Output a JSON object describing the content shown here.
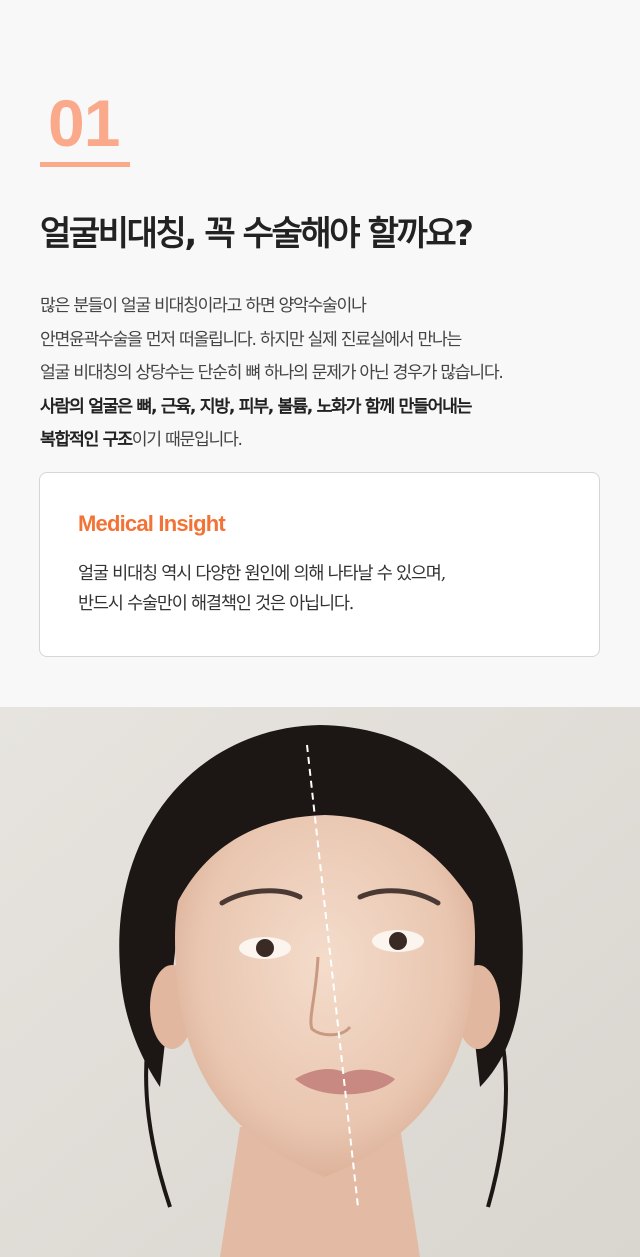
{
  "section": {
    "number": "01"
  },
  "headline": "얼굴비대칭, 꼭 수술해야 할까요?",
  "body": {
    "line1": "많은 분들이 얼굴 비대칭이라고 하면 양악수술이나",
    "line2": "안면윤곽수술을 먼저 떠올립니다. 하지만 실제 진료실에서 만나는",
    "line3": "얼굴 비대칭의 상당수는 단순히 뼈 하나의 문제가 아닌 경우가 많습니다.",
    "line4_bold": "사람의 얼굴은 뼈, 근육, 지방, 피부, 볼륨, 노화가 함께 만들어내는",
    "line5_bold": "복합적인 구조",
    "line5_rest": "이기 때문입니다."
  },
  "insight": {
    "title": "Medical Insight",
    "line1": "얼굴 비대칭 역시 다양한 원인에 의해 나타날 수 있으며,",
    "line2": "반드시 수술만이 해결책인 것은 아닙니다."
  },
  "colors": {
    "accent_peach": "#fba98b",
    "accent_orange": "#f37336",
    "background": "#f8f8f8",
    "card_border": "#d6d6d6"
  }
}
